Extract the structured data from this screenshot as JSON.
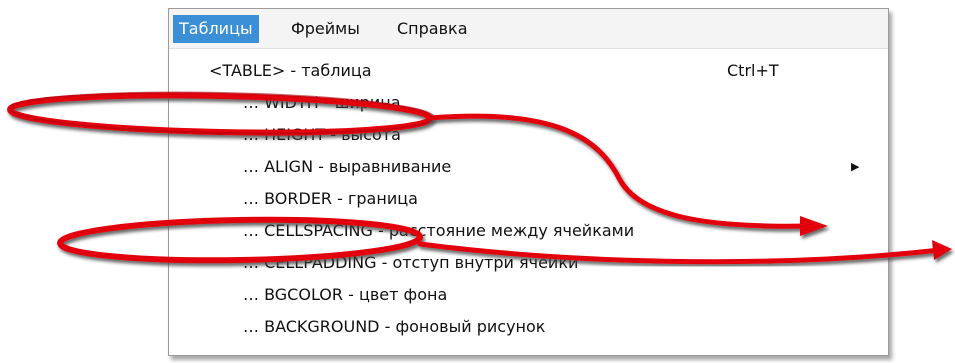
{
  "menubar": {
    "items": [
      {
        "label": "Таблицы",
        "active": true
      },
      {
        "label": "Фреймы",
        "active": false
      },
      {
        "label": "Справка",
        "active": false
      }
    ],
    "active_color": "#3b8fd6"
  },
  "dropdown": {
    "items": [
      {
        "label": "<TABLE> - таблица",
        "shortcut": "Ctrl+T"
      },
      {
        "label": "… WIDTH - ширина"
      },
      {
        "label": "… HEIGHT - высота"
      },
      {
        "label": "… ALIGN - выравнивание",
        "submenu_icon": "submenu-arrow-icon"
      },
      {
        "label": "… BORDER - граница"
      },
      {
        "label": "… CELLSPACING - расстояние между ячейками"
      },
      {
        "label": "… CELLPADDING - отступ внутри ячейки"
      },
      {
        "label": "… BGCOLOR - цвет фона"
      },
      {
        "label": "… BACKGROUND - фоновый рисунок"
      }
    ]
  },
  "annotations": {
    "color": "#e3000b",
    "shadow_color": "#555555",
    "marks": [
      "ellipse-width-highlight",
      "ellipse-cellspacing-highlight",
      "arrow-width",
      "arrow-cellspacing"
    ]
  }
}
